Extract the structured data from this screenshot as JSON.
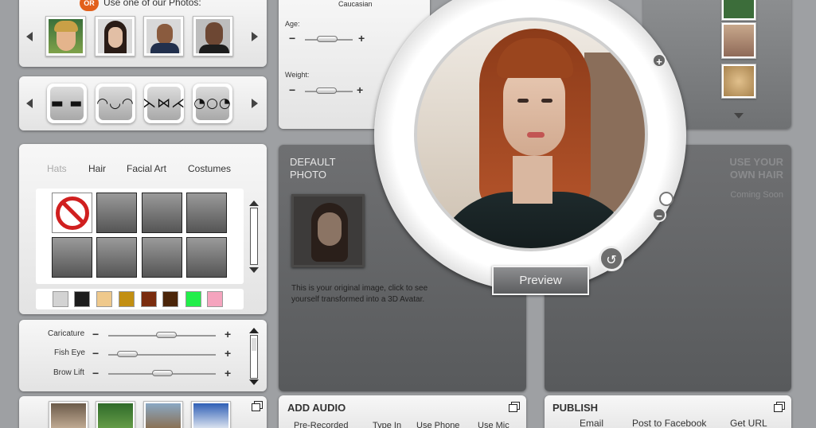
{
  "photos_panel": {
    "or_badge": "OR",
    "heading": "Use one of our Photos:"
  },
  "attributes": {
    "ethnicity_value": "Caucasian",
    "age_label": "Age:",
    "age_level": 0.45,
    "weight_label": "Weight:",
    "weight_level": 0.42,
    "minus": "−",
    "plus": "+"
  },
  "tabs": {
    "hats": "Hats",
    "hair": "Hair",
    "facial_art": "Facial Art",
    "costumes": "Costumes"
  },
  "hair_colors": [
    "#d3d3d3",
    "#1c1c1c",
    "#efc98c",
    "#c28f12",
    "#7a2c0e",
    "#4b2509",
    "#22ee4a",
    "#f5a4be"
  ],
  "face_sliders": {
    "caricature": {
      "label": "Caricature",
      "level": 0.55
    },
    "fish_eye": {
      "label": "Fish Eye",
      "level": 0.1
    },
    "brow_lift": {
      "label": "Brow Lift",
      "level": 0.5
    },
    "minus": "−",
    "plus": "+"
  },
  "default_photo": {
    "title_line1": "DEFAULT",
    "title_line2": "PHOTO",
    "description": "This is your original image, click to see yourself transformed into a 3D Avatar."
  },
  "own_hair": {
    "title_line1": "USE YOUR",
    "title_line2": "OWN HAIR",
    "status": "Coming Soon"
  },
  "preview": {
    "button": "Preview",
    "zoom_in": "+",
    "zoom_out": "−",
    "rotate": "↺"
  },
  "audio": {
    "title": "ADD AUDIO",
    "options": [
      "Pre-Recorded",
      "Type In",
      "Use Phone",
      "Use Mic"
    ]
  },
  "publish": {
    "title": "PUBLISH",
    "options": [
      "Email",
      "Post to Facebook",
      "Get URL"
    ]
  },
  "colors": {
    "accent_or": "#e2601b",
    "no_symbol": "#d01f1f",
    "background": "#9ea0a3"
  }
}
